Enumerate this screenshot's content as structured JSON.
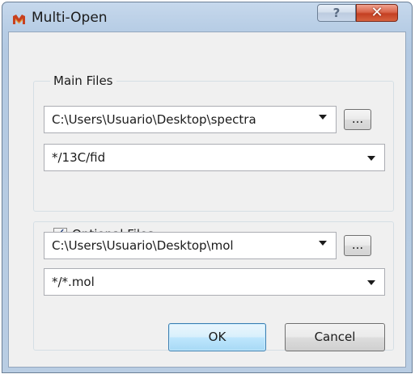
{
  "window": {
    "title": "Multi-Open",
    "help_glyph": "?",
    "close_glyph": "✕"
  },
  "main_files": {
    "legend": "Main Files",
    "folder_value": "C:\\Users\\Usuario\\Desktop\\spectra",
    "pattern_value": "*/13C/fid",
    "browse_label": "..."
  },
  "optional_files": {
    "legend": "Optional Files",
    "checked": true,
    "check_glyph": "✓",
    "folder_value": "C:\\Users\\Usuario\\Desktop\\mol",
    "pattern_value": "*/*.mol",
    "browse_label": "..."
  },
  "buttons": {
    "ok": "OK",
    "cancel": "Cancel"
  },
  "icons": {
    "app": "mnova-icon",
    "help": "help-icon",
    "close": "close-icon",
    "dropdown": "chevron-down-icon",
    "browse": "ellipsis-icon"
  },
  "colors": {
    "titlebar": "#b7cde5",
    "client_bg": "#f0f0f0",
    "close_red": "#c43f22",
    "default_button_border": "#3c7fb1"
  }
}
